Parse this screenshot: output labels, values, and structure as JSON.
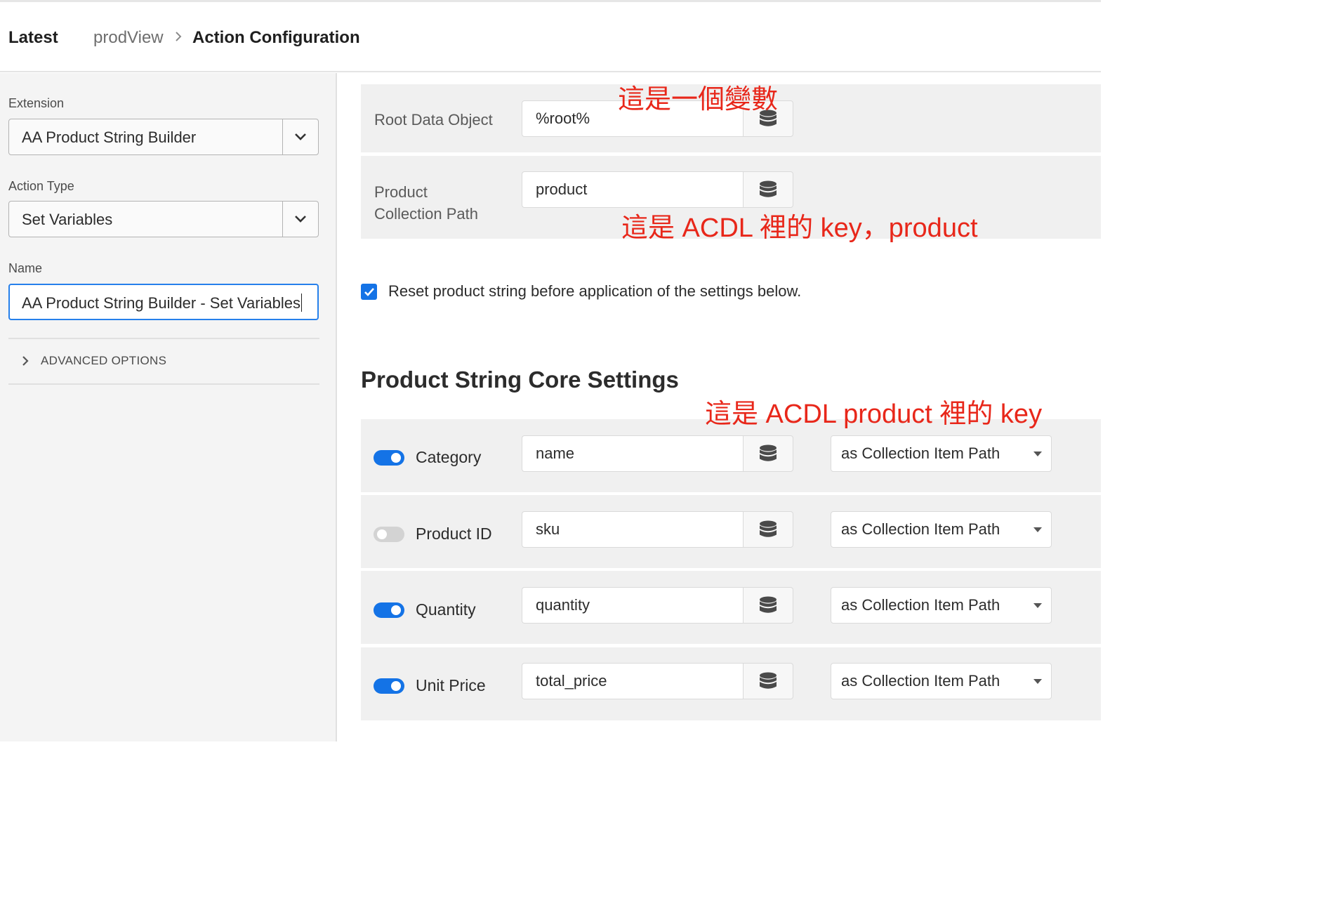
{
  "header": {
    "latest": "Latest",
    "breadcrumb": [
      "prodView",
      "Action Configuration"
    ]
  },
  "sidebar": {
    "extension": {
      "label": "Extension",
      "value": "AA Product String Builder"
    },
    "action_type": {
      "label": "Action Type",
      "value": "Set Variables"
    },
    "name": {
      "label": "Name",
      "value": "AA Product String Builder - Set Variables"
    },
    "advanced_options": "ADVANCED OPTIONS"
  },
  "main": {
    "root_data_object": {
      "label": "Root Data Object",
      "value": "%root%"
    },
    "product_collection_path": {
      "label_line1": "Product",
      "label_line2": "Collection Path",
      "value": "product"
    },
    "reset_checkbox": {
      "checked": true,
      "label": "Reset product string before application of the settings below."
    },
    "section_title": "Product String Core Settings",
    "rows": [
      {
        "label": "Category",
        "enabled": true,
        "value": "name",
        "mode": "as Collection Item Path"
      },
      {
        "label": "Product ID",
        "enabled": false,
        "value": "sku",
        "mode": "as Collection Item Path"
      },
      {
        "label": "Quantity",
        "enabled": true,
        "value": "quantity",
        "mode": "as Collection Item Path"
      },
      {
        "label": "Unit Price",
        "enabled": true,
        "value": "total_price",
        "mode": "as Collection Item Path"
      }
    ]
  },
  "annotations": {
    "variable_note": "這是一個變數",
    "key_note": "這是 ACDL 裡的 key，product",
    "product_key_note": "這是 ACDL product 裡的 key"
  },
  "colors": {
    "accent": "#1473e6",
    "focus_border": "#2680eb",
    "annotation": "#e8271a",
    "toggle_off": "#d3d3d3"
  }
}
